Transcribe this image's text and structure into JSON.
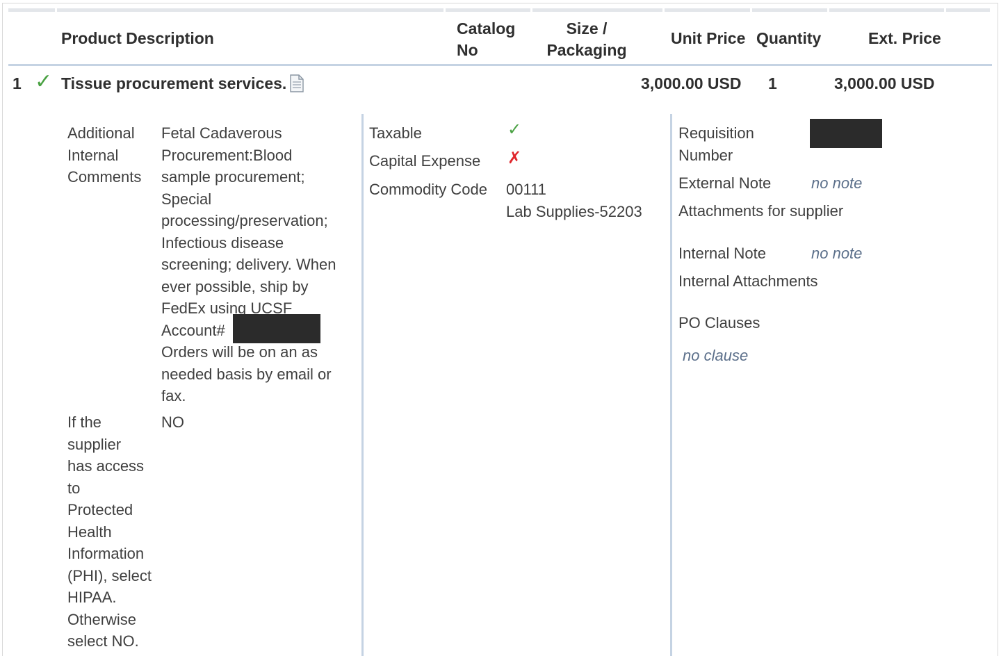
{
  "header": {
    "product_description": "Product Description",
    "catalog_no": [
      "Catalog",
      "No"
    ],
    "size_packaging": [
      "Size /",
      "Packaging"
    ],
    "unit_price": "Unit Price",
    "quantity": "Quantity",
    "ext_price": "Ext. Price"
  },
  "line_item": {
    "number": "1",
    "description": "Tissue procurement services.",
    "unit_price": "3,000.00 USD",
    "quantity": "1",
    "ext_price": "3,000.00 USD"
  },
  "left_panel": {
    "comments_label": [
      "Additional",
      "Internal",
      "Comments"
    ],
    "comments_lines": [
      "Fetal Cadaverous",
      "Procurement:Blood",
      "sample procurement;",
      "Special",
      "processing/preservation;",
      "Infectious disease",
      "screening; delivery. When",
      "ever possible, ship by",
      "FedEx using UCSF"
    ],
    "account_prefix": "Account#",
    "account_suffix": ".",
    "comments_tail": [
      "Orders will be on an as",
      "needed basis by email or",
      "fax."
    ],
    "phi_label": [
      "If the",
      "supplier",
      "has access",
      "to",
      "Protected",
      "Health",
      "Information",
      "(PHI), select",
      "HIPAA.",
      "Otherwise",
      "select NO."
    ],
    "phi_value": "NO"
  },
  "middle_panel": {
    "taxable_label": "Taxable",
    "capital_expense_label": "Capital Expense",
    "commodity_code_label": "Commodity Code",
    "commodity_code": "00111",
    "commodity_desc": "Lab Supplies-52203",
    "taxable_icon": "check-icon",
    "capital_expense_icon": "x-icon"
  },
  "right_panel": {
    "requisition_label": [
      "Requisition",
      "Number"
    ],
    "external_note_label": "External Note",
    "external_note_value": "no note",
    "attachments_supplier": "Attachments for supplier",
    "internal_note_label": "Internal Note",
    "internal_note_value": "no note",
    "internal_attachments": "Internal Attachments",
    "po_clauses_label": "PO Clauses",
    "po_clauses_value": "no clause"
  },
  "colors": {
    "check_green": "#49a142",
    "x_red": "#e0262c",
    "note_blue": "#5b6f8a",
    "separator": "#c5d3e3"
  }
}
